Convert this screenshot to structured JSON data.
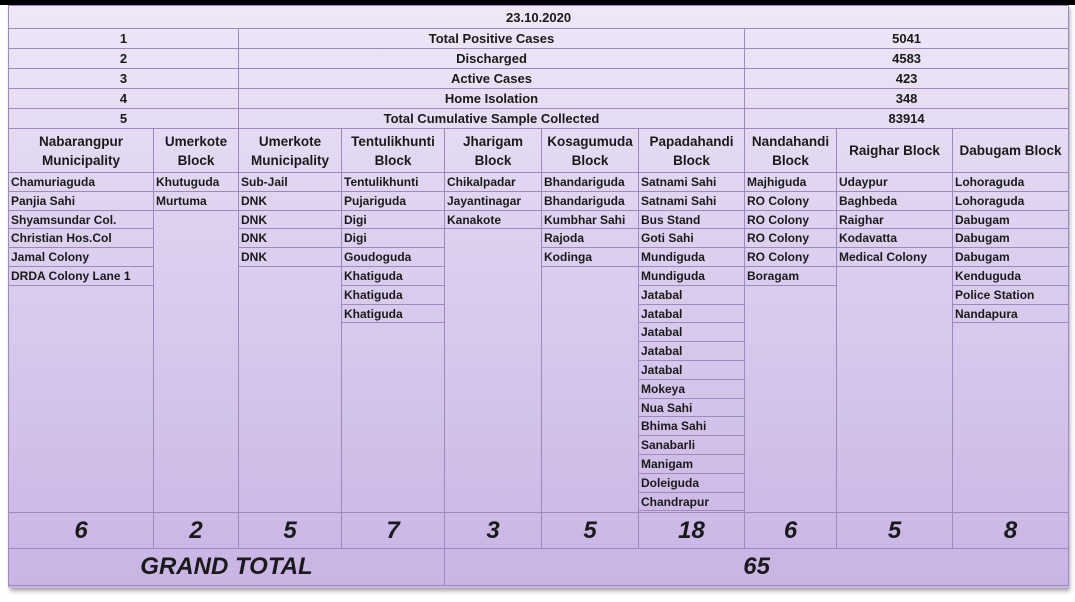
{
  "date": "23.10.2020",
  "summary": [
    {
      "no": "1",
      "label": "Total Positive Cases",
      "value": "5041"
    },
    {
      "no": "2",
      "label": "Discharged",
      "value": "4583"
    },
    {
      "no": "3",
      "label": "Active Cases",
      "value": "423"
    },
    {
      "no": "4",
      "label": "Home Isolation",
      "value": "348"
    },
    {
      "no": "5",
      "label": "Total Cumulative Sample Collected",
      "value": "83914"
    }
  ],
  "columns": [
    {
      "line1": "Nabarangpur",
      "line2": "Municipality",
      "total": "6",
      "areas": [
        "Chamuriaguda",
        "Panjia Sahi",
        "Shyamsundar Col.",
        "Christian Hos.Col",
        "Jamal Colony",
        "DRDA Colony Lane 1"
      ]
    },
    {
      "line1": "Umerkote",
      "line2": "Block",
      "total": "2",
      "areas": [
        "Khutuguda",
        "Murtuma"
      ]
    },
    {
      "line1": "Umerkote",
      "line2": "Municipality",
      "total": "5",
      "areas": [
        "Sub-Jail",
        "DNK",
        "DNK",
        "DNK",
        "DNK"
      ]
    },
    {
      "line1": "Tentulikhunti",
      "line2": "Block",
      "total": "7",
      "areas": [
        "Tentulikhunti",
        "Pujariguda",
        "Digi",
        "Digi",
        "Goudoguda",
        "Khatiguda",
        "Khatiguda",
        "Khatiguda"
      ]
    },
    {
      "line1": "Jharigam",
      "line2": "Block",
      "total": "3",
      "areas": [
        "Chikalpadar",
        "Jayantinagar",
        "Kanakote"
      ]
    },
    {
      "line1": "Kosagumuda",
      "line2": "Block",
      "total": "5",
      "areas": [
        "Bhandariguda",
        "Bhandariguda",
        "Kumbhar Sahi",
        "Rajoda",
        "Kodinga"
      ]
    },
    {
      "line1": "Papadahandi",
      "line2": "Block",
      "total": "18",
      "areas": [
        "Satnami Sahi",
        "Satnami Sahi",
        "Bus Stand",
        "Goti Sahi",
        "Mundiguda",
        "Mundiguda",
        "Jatabal",
        "Jatabal",
        "Jatabal",
        "Jatabal",
        "Jatabal",
        "Mokeya",
        "Nua Sahi",
        "Bhima Sahi",
        "Sanabarli",
        "Manigam",
        "Doleiguda",
        "Chandrapur"
      ]
    },
    {
      "line1": "Nandahandi",
      "line2": "Block",
      "total": "6",
      "areas": [
        "Majhiguda",
        "RO Colony",
        "RO Colony",
        "RO Colony",
        "RO Colony",
        "Boragam"
      ]
    },
    {
      "line1": "Raighar Block",
      "line2": "",
      "total": "5",
      "areas": [
        "Udaypur",
        "Baghbeda",
        "Raighar",
        "Kodavatta",
        "Medical Colony"
      ]
    },
    {
      "line1": "Dabugam Block",
      "line2": "",
      "total": "8",
      "areas": [
        "Lohoraguda",
        "Lohoraguda",
        "Dabugam",
        "Dabugam",
        "Dabugam",
        "Kenduguda",
        "Police Station",
        "Nandapura"
      ]
    }
  ],
  "grand_total": {
    "label": "GRAND TOTAL",
    "value": "65"
  },
  "colors": {
    "background": "#ddd0ef",
    "border": "#9e88bd"
  }
}
